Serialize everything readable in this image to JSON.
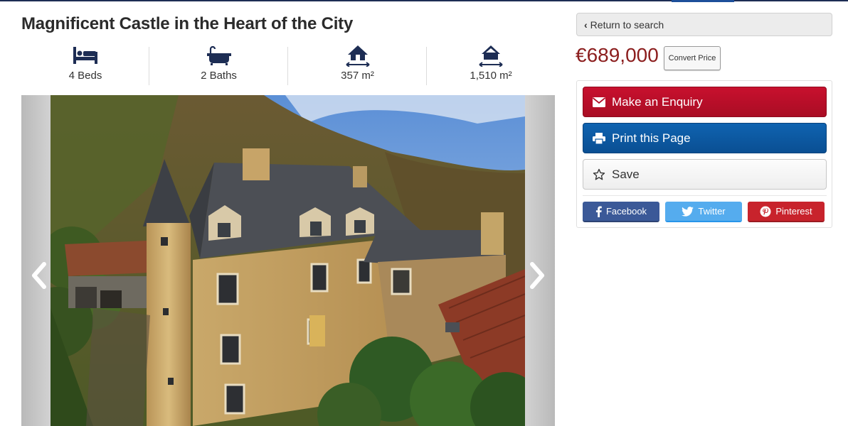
{
  "listing": {
    "title": "Magnificent Castle in the Heart of the City",
    "features": [
      {
        "icon": "bed-icon",
        "label": "4 Beds"
      },
      {
        "icon": "bath-icon",
        "label": "2 Baths"
      },
      {
        "icon": "house-area-icon",
        "label": "357 m²"
      },
      {
        "icon": "land-area-icon",
        "label": "1,510 m²"
      }
    ],
    "photo": {
      "subject": "castle-photo"
    }
  },
  "sidebar": {
    "return_label": "Return to search",
    "price": "€689,000",
    "convert_label": "Convert Price",
    "actions": {
      "enquiry": "Make an Enquiry",
      "print": "Print this Page",
      "save": "Save"
    },
    "social": {
      "facebook": "Facebook",
      "twitter": "Twitter",
      "pinterest": "Pinterest"
    }
  },
  "colors": {
    "price": "#8b1d1d",
    "enquiry": "#c8102e",
    "print": "#0f63b0",
    "facebook": "#3b5998",
    "twitter": "#55acee",
    "pinterest": "#c8232c",
    "nav_accent": "#1d2d54"
  }
}
